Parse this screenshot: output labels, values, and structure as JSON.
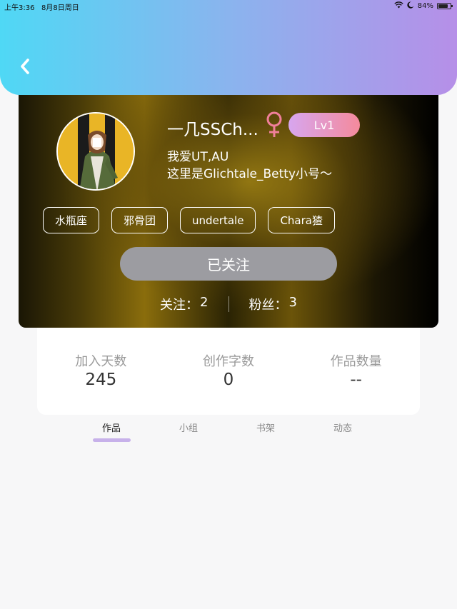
{
  "status_bar": {
    "time": "上午3:36",
    "date": "8月8日周日",
    "battery": "84%",
    "battery_level": 0.84
  },
  "profile": {
    "username": "一几SSCh...",
    "gender_symbol": "♀",
    "level": "Lv1",
    "bio_line1": "我爱UT,AU",
    "bio_line2": "这里是Glichtale_Betty小号～",
    "tags": [
      "水瓶座",
      "邪骨团",
      "undertale",
      "Chara猹"
    ],
    "follow_button": "已关注",
    "following_label": "关注：",
    "following_count": "2",
    "followers_label": "粉丝：",
    "followers_count": "3"
  },
  "stats": [
    {
      "label": "加入天数",
      "value": "245"
    },
    {
      "label": "创作字数",
      "value": "0"
    },
    {
      "label": "作品数量",
      "value": "--"
    }
  ],
  "tabs": [
    {
      "label": "作品",
      "active": true
    },
    {
      "label": "小组",
      "active": false
    },
    {
      "label": "书架",
      "active": false
    },
    {
      "label": "动态",
      "active": false
    }
  ],
  "colors": {
    "header_gradient": [
      "#4fd8f5",
      "#b68fe8"
    ],
    "level_badge": [
      "#d7a6ef",
      "#f48a9c"
    ],
    "gender_icon": "#f07f9a",
    "tab_indicator": "#c7b1ea",
    "follow_button": "#9c9ca1"
  }
}
